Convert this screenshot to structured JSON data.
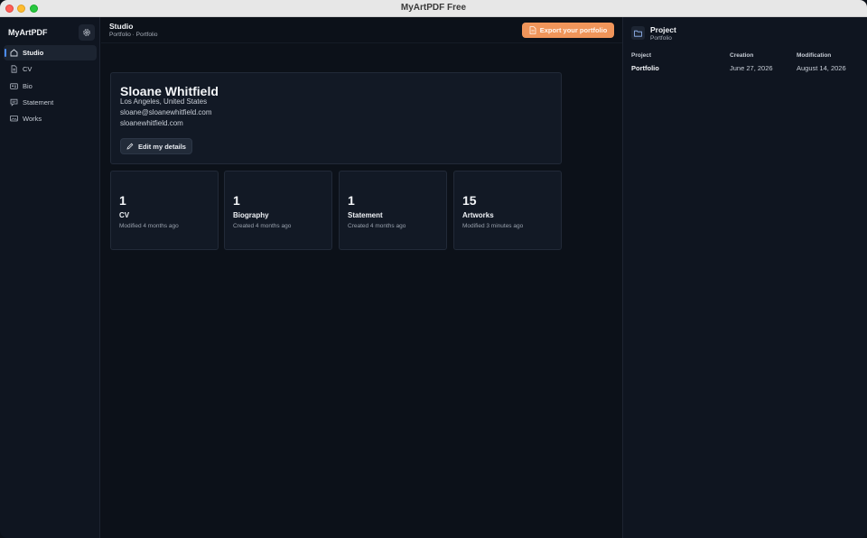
{
  "window": {
    "title": "MyArtPDF Free"
  },
  "sidebar": {
    "app_name": "MyArtPDF",
    "items": [
      {
        "label": "Studio",
        "icon": "home-icon",
        "active": true
      },
      {
        "label": "CV",
        "icon": "document-icon",
        "active": false
      },
      {
        "label": "Bio",
        "icon": "id-card-icon",
        "active": false
      },
      {
        "label": "Statement",
        "icon": "speech-bubble-icon",
        "active": false
      },
      {
        "label": "Works",
        "icon": "gallery-icon",
        "active": false
      }
    ]
  },
  "header": {
    "title": "Studio",
    "breadcrumb": "Portfolio · Portfolio",
    "export_label": "Export your portfolio"
  },
  "profile": {
    "name": "Sloane Whitfield",
    "location": "Los Angeles, United States",
    "email": "sloane@sloanewhitfield.com",
    "website": "sloanewhitfield.com",
    "edit_label": "Edit my details"
  },
  "stats": [
    {
      "value": "1",
      "label": "CV",
      "sub": "Modified 4 months ago"
    },
    {
      "value": "1",
      "label": "Biography",
      "sub": "Created 4 months ago"
    },
    {
      "value": "1",
      "label": "Statement",
      "sub": "Created 4 months ago"
    },
    {
      "value": "15",
      "label": "Artworks",
      "sub": "Modified 3 minutes ago"
    }
  ],
  "project_panel": {
    "title": "Project",
    "subtitle": "Portfolio",
    "columns": [
      "Project",
      "Creation",
      "Modification"
    ],
    "row": {
      "project": "Portfolio",
      "creation": "June 27, 2026",
      "modification": "August 14, 2026"
    }
  },
  "colors": {
    "accent": "#f0955a",
    "active_marker": "#4c8dff",
    "background": "#0c1119"
  }
}
